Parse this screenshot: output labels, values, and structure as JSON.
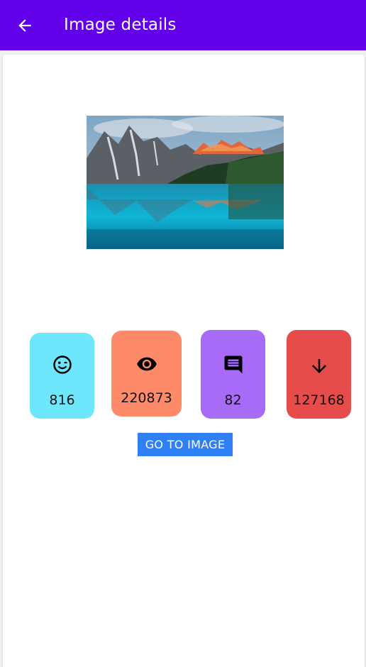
{
  "app_bar": {
    "title": "Image details",
    "background": "#6200ea",
    "back_icon": "arrow-back-icon"
  },
  "image": {
    "subject": "mountain-lake-photo"
  },
  "stats": [
    {
      "name": "likes",
      "icon": "smile-icon",
      "count": "816",
      "color": "#6ee7fd"
    },
    {
      "name": "views",
      "icon": "eye-icon",
      "count": "220873",
      "color": "#ff8a6a"
    },
    {
      "name": "comments",
      "icon": "comment-icon",
      "count": "82",
      "color": "#a86bf7"
    },
    {
      "name": "downloads",
      "icon": "download-arrow-icon",
      "count": "127168",
      "color": "#e74c4c"
    }
  ],
  "go_button": {
    "label": "GO TO IMAGE",
    "color": "#2f80f5"
  }
}
